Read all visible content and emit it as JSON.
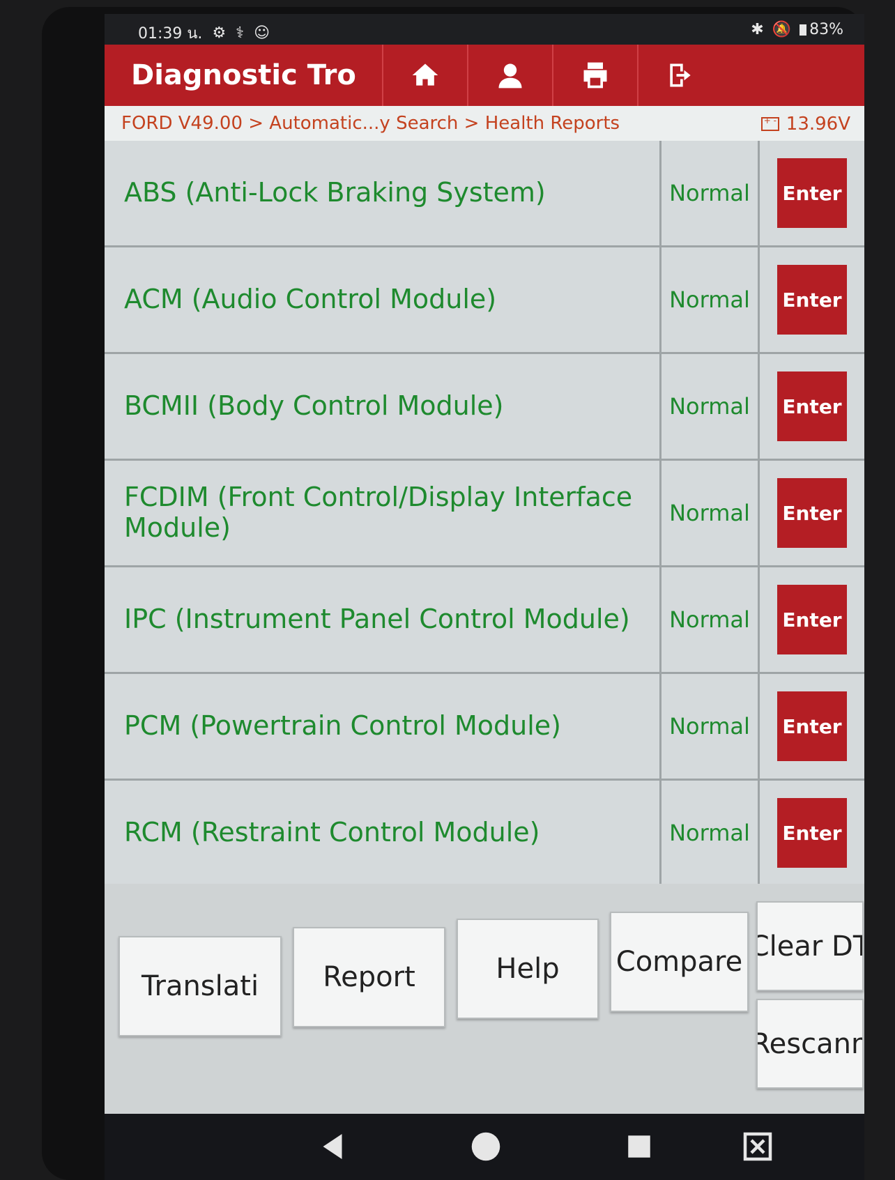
{
  "status_bar": {
    "time": "01:39 น.",
    "battery": "83%"
  },
  "header": {
    "title": "Diagnostic Tro",
    "buttons": [
      "home-icon",
      "support-icon",
      "print-icon",
      "exit-icon"
    ]
  },
  "breadcrumb": {
    "path": "FORD V49.00 > Automatic...y Search > Health Reports",
    "voltage": "13.96V"
  },
  "modules": [
    {
      "name": "ABS (Anti-Lock Braking System)",
      "status": "Normal",
      "action": "Enter"
    },
    {
      "name": "ACM (Audio Control Module)",
      "status": "Normal",
      "action": "Enter"
    },
    {
      "name": "BCMII (Body Control Module)",
      "status": "Normal",
      "action": "Enter"
    },
    {
      "name": "FCDIM (Front Control/Display Interface Module)",
      "status": "Normal",
      "action": "Enter"
    },
    {
      "name": "IPC (Instrument Panel Control Module)",
      "status": "Normal",
      "action": "Enter"
    },
    {
      "name": "PCM (Powertrain Control Module)",
      "status": "Normal",
      "action": "Enter"
    },
    {
      "name": "RCM (Restraint Control Module)",
      "status": "Normal",
      "action": "Enter"
    }
  ],
  "footer": {
    "translation": "Translati",
    "report": "Report",
    "help": "Help",
    "compare": "Compare",
    "clear_dtc": "Clear DT",
    "rescan": "Rescann"
  },
  "colors": {
    "header_red": "#b41e24",
    "status_green": "#1e8a2e",
    "breadcrumb_orange": "#c4421f"
  }
}
